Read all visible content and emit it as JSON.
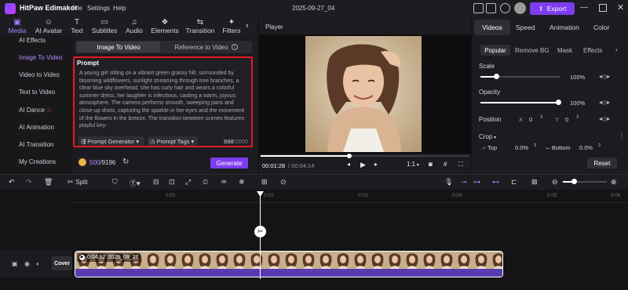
{
  "app": {
    "name": "HitPaw Edimakor",
    "menu": [
      "File",
      "Settings",
      "Help"
    ],
    "project_title": "2025-09-27_04",
    "export_label": "Export",
    "brand_color": "#7e3cf0"
  },
  "tool_tabs": [
    {
      "label": "Media",
      "icon": "media-icon",
      "glyph": "▣",
      "active": true
    },
    {
      "label": "AI Avatar",
      "icon": "avatar-icon",
      "glyph": "☺"
    },
    {
      "label": "Text",
      "icon": "text-icon",
      "glyph": "T"
    },
    {
      "label": "Subtitles",
      "icon": "subtitles-icon",
      "glyph": "▭"
    },
    {
      "label": "Audio",
      "icon": "audio-icon",
      "glyph": "♫"
    },
    {
      "label": "Elements",
      "icon": "elements-icon",
      "glyph": "❖"
    },
    {
      "label": "Transition",
      "icon": "transition-icon",
      "glyph": "⇆"
    },
    {
      "label": "Filters",
      "icon": "filters-icon",
      "glyph": "✦"
    }
  ],
  "sidebar": {
    "items": [
      {
        "label": "AI Effects"
      },
      {
        "label": "Image To Video",
        "active": true
      },
      {
        "label": "Video to Video"
      },
      {
        "label": "Text to Video"
      },
      {
        "label": "AI Dance"
      },
      {
        "label": "AI Animation"
      },
      {
        "label": "AI Transition"
      },
      {
        "label": "My Creations"
      }
    ]
  },
  "content": {
    "tabs": [
      "Image To Video",
      "Reference to Video"
    ],
    "prompt_label": "Prompt",
    "prompt_text": "A young girl sitting on a vibrant green grassy hill, surrounded by blooming wildflowers, sunlight streaming through tree branches, a clear blue sky overhead; she has curly hair and wears a colorful summer dress, her laughter is infectious, casting a warm, joyous atmosphere. The camera performs smooth, sweeping pans and close-up shots, capturing the sparkle in her eyes and the movement of the flowers in the breeze. The transition between scenes features playful key-",
    "prompt_generator": "Prompt Generator",
    "prompt_tags": "Prompt Tags",
    "char_count": "698",
    "char_max": "/2000",
    "credits_used": "500",
    "credits_total": "/9196",
    "generate_label": "Generate"
  },
  "player": {
    "title": "Player",
    "time_current": "00:01:28",
    "time_total": "/ 00:04:14",
    "speed": "1:1",
    "progress": 0.43
  },
  "props": {
    "tabs": [
      "Videos",
      "Speed",
      "Animation",
      "Color"
    ],
    "subtabs": [
      "Popular",
      "Remove BG",
      "Mask",
      "Effects"
    ],
    "scale_label": "Scale",
    "scale_value": "100%",
    "opacity_label": "Opacity",
    "opacity_value": "100%",
    "position_label": "Position",
    "pos_x_label": "X",
    "pos_x": "0",
    "pos_y_label": "Y",
    "pos_y": "0",
    "crop_label": "Crop",
    "crop_top_label": "Top",
    "crop_top": "0.0%",
    "crop_bottom_label": "Bottom",
    "crop_bottom": "0.0%",
    "reset_label": "Reset"
  },
  "timeline": {
    "split_label": "Split",
    "ticks": [
      "0:01",
      "0:02",
      "0:03",
      "0:04",
      "0:05",
      "0:06"
    ],
    "cover_label": "Cover",
    "clip_duration": "0:04:12",
    "clip_name": "2025_09_27"
  }
}
